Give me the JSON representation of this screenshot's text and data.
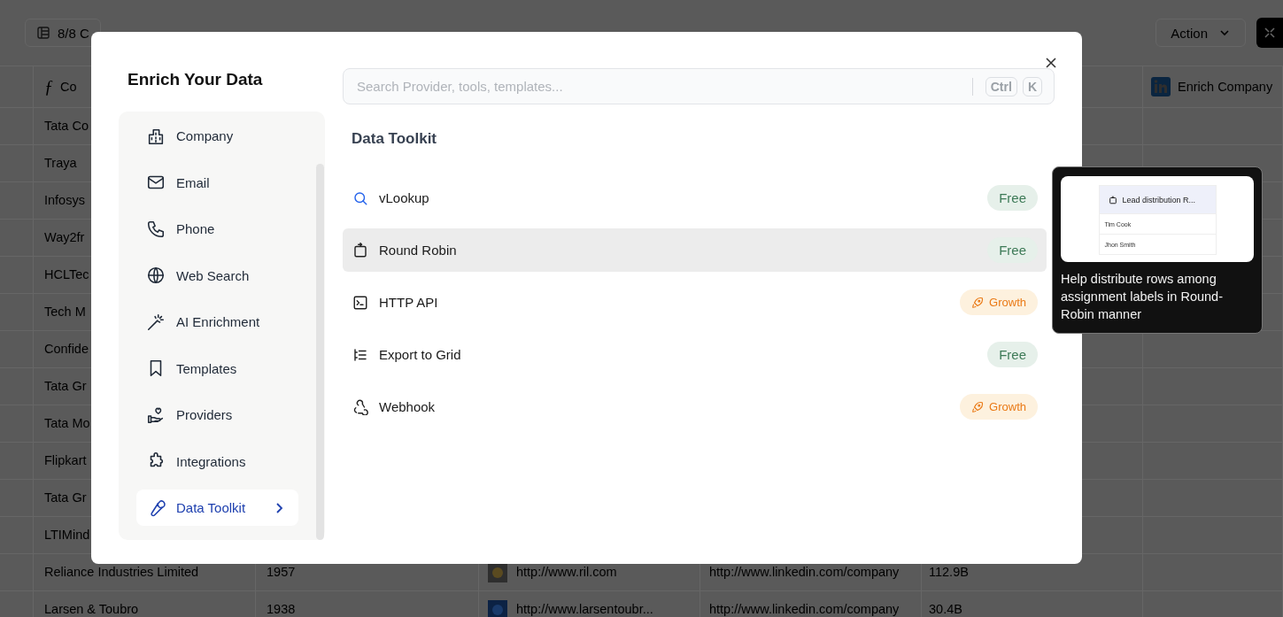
{
  "toolbar": {
    "columns_button": "8/8 C",
    "action_button": "Action"
  },
  "table": {
    "header": {
      "first_column_icon": "ƒ",
      "first_column": "Co",
      "last_column": "Enrich Company"
    },
    "rows": [
      {
        "name": "Tata Co"
      },
      {
        "name": "Traya"
      },
      {
        "name": "Infosys"
      },
      {
        "name": "Way2fr"
      },
      {
        "name": "HCLTec"
      },
      {
        "name": "Tech M"
      },
      {
        "name": "Confide"
      },
      {
        "name": "Tata Gr"
      },
      {
        "name": "Tata Mo"
      },
      {
        "name": "Flipkart"
      },
      {
        "name": "Tata Gr"
      },
      {
        "name": "LTIMind"
      },
      {
        "name": "Reliance Industries Limited",
        "year": "1957",
        "website": "http://www.ril.com",
        "linkedin": "http://www.linkedin.com/company",
        "revenue": "112.9B"
      },
      {
        "name": "Larsen & Toubro",
        "year": "1938",
        "website": "http://www.larsentoubr...",
        "linkedin": "http://www.linkedin.com/company",
        "revenue": "30.4B"
      }
    ]
  },
  "modal": {
    "title": "Enrich Your Data",
    "search": {
      "placeholder": "Search Provider, tools, templates...",
      "shortcut_keys": [
        "Ctrl",
        "K"
      ]
    },
    "nav_items": [
      {
        "label": "Company",
        "selected": false
      },
      {
        "label": "Email",
        "selected": false
      },
      {
        "label": "Phone",
        "selected": false
      },
      {
        "label": "Web Search",
        "selected": false
      },
      {
        "label": "AI Enrichment",
        "selected": false
      },
      {
        "label": "Templates",
        "selected": false
      },
      {
        "label": "Providers",
        "selected": false
      },
      {
        "label": "Integrations",
        "selected": false
      },
      {
        "label": "Data Toolkit",
        "selected": true
      }
    ],
    "section_title": "Data Toolkit",
    "tools": [
      {
        "label": "vLookup",
        "selected": false,
        "badge": {
          "label": "Free",
          "kind": "free"
        }
      },
      {
        "label": "Round Robin",
        "selected": true,
        "badge": {
          "label": "Free",
          "kind": "free"
        }
      },
      {
        "label": "HTTP API",
        "selected": false,
        "badge": {
          "label": "Growth",
          "kind": "growth"
        }
      },
      {
        "label": "Export to Grid",
        "selected": false,
        "badge": {
          "label": "Free",
          "kind": "free"
        }
      },
      {
        "label": "Webhook",
        "selected": false,
        "badge": {
          "label": "Growth",
          "kind": "growth"
        }
      }
    ]
  },
  "tooltip": {
    "preview": {
      "header": "Lead distribution R...",
      "rows": [
        "Tim Cook",
        "Jhon Smith"
      ]
    },
    "text": "Help distribute rows among assignment labels in Round-Robin manner"
  }
}
